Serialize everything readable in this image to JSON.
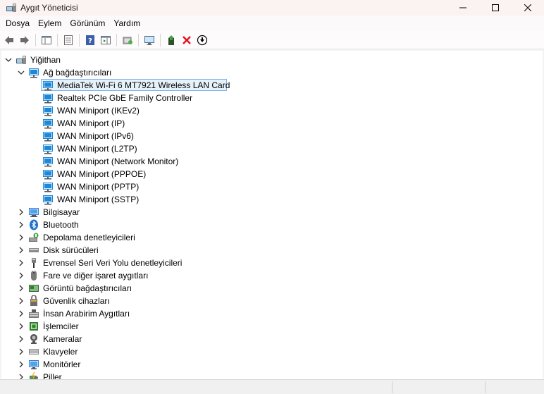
{
  "window": {
    "title": "Aygıt Yöneticisi",
    "controls": [
      "minimize",
      "maximize",
      "close"
    ]
  },
  "menubar": {
    "items": [
      {
        "label": "Dosya"
      },
      {
        "label": "Eylem"
      },
      {
        "label": "Görünüm"
      },
      {
        "label": "Yardım"
      }
    ]
  },
  "toolbar": {
    "buttons": [
      "back-arrow",
      "forward-arrow",
      "show-hide-console-tree",
      "properties",
      "help",
      "action-pane",
      "scan-hardware",
      "computer-monitor",
      "update-driver",
      "uninstall-device",
      "disable-device"
    ]
  },
  "tree": {
    "root": {
      "label": "Yiğithan"
    },
    "network": {
      "label": "Ağ bağdaştırıcıları",
      "children": [
        {
          "label": "MediaTek Wi-Fi 6 MT7921 Wireless LAN Card",
          "selected": true
        },
        {
          "label": "Realtek PCIe GbE Family Controller"
        },
        {
          "label": "WAN Miniport (IKEv2)"
        },
        {
          "label": "WAN Miniport (IP)"
        },
        {
          "label": "WAN Miniport (IPv6)"
        },
        {
          "label": "WAN Miniport (L2TP)"
        },
        {
          "label": "WAN Miniport (Network Monitor)"
        },
        {
          "label": "WAN Miniport (PPPOE)"
        },
        {
          "label": "WAN Miniport (PPTP)"
        },
        {
          "label": "WAN Miniport (SSTP)"
        }
      ]
    },
    "categories": [
      {
        "label": "Bilgisayar",
        "icon": "computer-icon"
      },
      {
        "label": "Bluetooth",
        "icon": "bluetooth-icon"
      },
      {
        "label": "Depolama denetleyicileri",
        "icon": "storage-controller-icon"
      },
      {
        "label": "Disk sürücüleri",
        "icon": "disk-drive-icon"
      },
      {
        "label": "Evrensel Seri Veri Yolu denetleyicileri",
        "icon": "usb-controller-icon"
      },
      {
        "label": "Fare ve diğer işaret aygıtları",
        "icon": "mouse-icon"
      },
      {
        "label": "Görüntü bağdaştırıcıları",
        "icon": "display-adapter-icon"
      },
      {
        "label": "Güvenlik cihazları",
        "icon": "security-device-icon"
      },
      {
        "label": "İnsan Arabirim Aygıtları",
        "icon": "hid-icon"
      },
      {
        "label": "İşlemciler",
        "icon": "processor-icon"
      },
      {
        "label": "Kameralar",
        "icon": "camera-icon"
      },
      {
        "label": "Klavyeler",
        "icon": "keyboard-icon"
      },
      {
        "label": "Monitörler",
        "icon": "monitor-icon"
      },
      {
        "label": "Piller",
        "icon": "battery-icon"
      }
    ]
  },
  "colors": {
    "selection_fill": "#e5f1fb",
    "selection_border": "#7eb4ea",
    "network_icon": "#1e88d8",
    "delete_red": "#e81123"
  }
}
